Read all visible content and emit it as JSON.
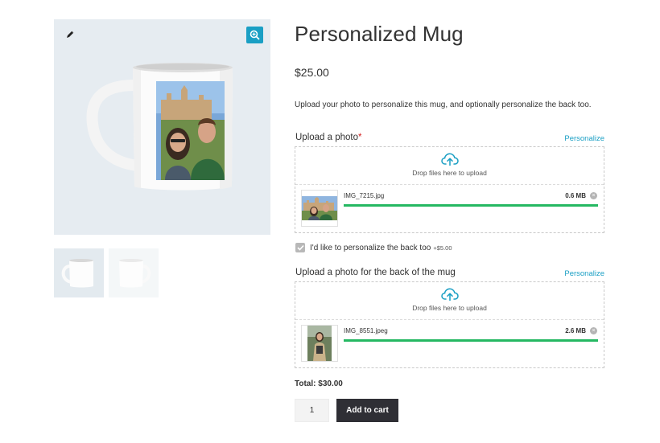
{
  "gallery": {
    "edit_icon": "pencil-icon",
    "zoom_icon": "zoom-in-icon",
    "accent_color": "#1a9fc4"
  },
  "product": {
    "title": "Personalized Mug",
    "price": "$25.00",
    "description": "Upload your photo to personalize this mug, and optionally personalize the back too."
  },
  "upload_front": {
    "label": "Upload a photo",
    "required_mark": "*",
    "personalize_link": "Personalize",
    "dropzone_text": "Drop files here to upload",
    "file": {
      "name": "IMG_7215.jpg",
      "size": "0.6 MB",
      "progress": 1.0,
      "remove": "×"
    }
  },
  "back_option": {
    "checked": true,
    "label": "I'd like to personalize the back too",
    "extra_price": "+$5.00"
  },
  "upload_back": {
    "label": "Upload a photo for the back of the mug",
    "personalize_link": "Personalize",
    "dropzone_text": "Drop files here to upload",
    "file": {
      "name": "IMG_8551.jpeg",
      "size": "2.6 MB",
      "progress": 1.0,
      "remove": "×"
    }
  },
  "cart": {
    "total": "Total: $30.00",
    "quantity": "1",
    "add_to_cart": "Add to cart"
  },
  "colors": {
    "progress": "#25b862",
    "link": "#1a9fc4",
    "button": "#2f2f35"
  }
}
